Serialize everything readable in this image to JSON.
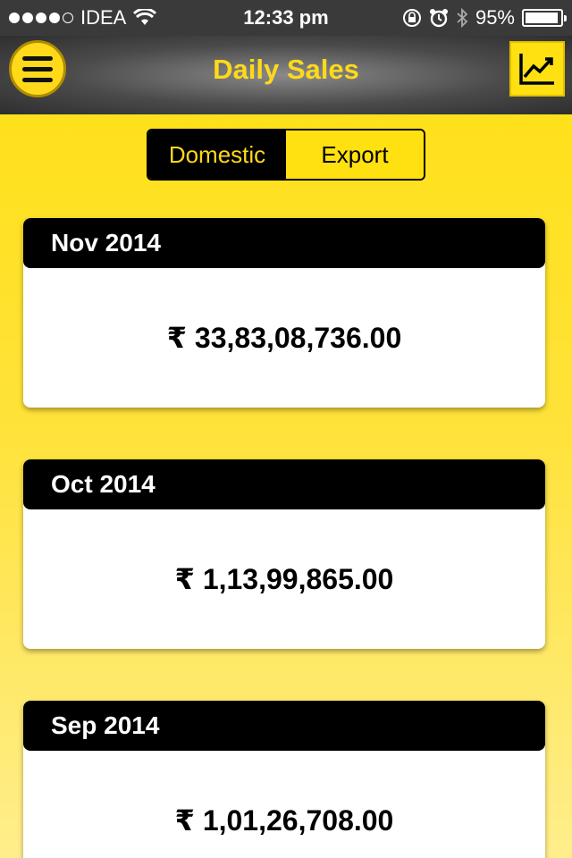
{
  "status": {
    "carrier": "IDEA",
    "time": "12:33 pm",
    "battery": "95%",
    "battery_level": 0.95
  },
  "nav": {
    "title": "Daily Sales",
    "menu_icon": "hamburger-menu-icon",
    "chart_icon": "trend-chart-icon"
  },
  "tabs": {
    "domestic": "Domestic",
    "export": "Export",
    "selected": "Domestic"
  },
  "colors": {
    "accent_yellow": "#FFD91A",
    "header_black": "#000000"
  },
  "sales": [
    {
      "month": "Nov 2014",
      "amount": "₹ 33,83,08,736.00"
    },
    {
      "month": "Oct 2014",
      "amount": "₹ 1,13,99,865.00"
    },
    {
      "month": "Sep 2014",
      "amount": "₹ 1,01,26,708.00"
    }
  ]
}
